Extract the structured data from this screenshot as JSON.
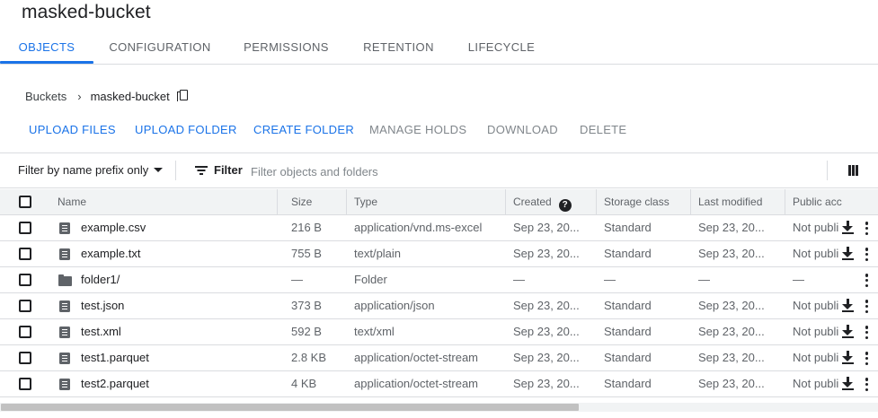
{
  "bucket": {
    "name": "masked-bucket"
  },
  "tabs": [
    {
      "label": "OBJECTS",
      "active": true
    },
    {
      "label": "CONFIGURATION",
      "active": false
    },
    {
      "label": "PERMISSIONS",
      "active": false
    },
    {
      "label": "RETENTION",
      "active": false
    },
    {
      "label": "LIFECYCLE",
      "active": false
    }
  ],
  "breadcrumb": {
    "root": "Buckets",
    "separator": "›",
    "current": "masked-bucket"
  },
  "actions": [
    {
      "label": "UPLOAD FILES",
      "enabled": true
    },
    {
      "label": "UPLOAD FOLDER",
      "enabled": true
    },
    {
      "label": "CREATE FOLDER",
      "enabled": true
    },
    {
      "label": "MANAGE HOLDS",
      "enabled": false
    },
    {
      "label": "DOWNLOAD",
      "enabled": false
    },
    {
      "label": "DELETE",
      "enabled": false
    }
  ],
  "filter": {
    "mode_label": "Filter by name prefix only",
    "button_label": "Filter",
    "placeholder": "Filter objects and folders"
  },
  "table": {
    "columns": [
      "Name",
      "Size",
      "Type",
      "Created",
      "Storage class",
      "Last modified",
      "Public acc"
    ],
    "rows": [
      {
        "name": "example.csv",
        "kind": "file",
        "size": "216 B",
        "type": "application/vnd.ms-excel",
        "created": "Sep 23, 20...",
        "storage": "Standard",
        "modified": "Sep 23, 20...",
        "public": "Not publi"
      },
      {
        "name": "example.txt",
        "kind": "file",
        "size": "755 B",
        "type": "text/plain",
        "created": "Sep 23, 20...",
        "storage": "Standard",
        "modified": "Sep 23, 20...",
        "public": "Not publi"
      },
      {
        "name": "folder1/",
        "kind": "folder",
        "size": "—",
        "type": "Folder",
        "created": "—",
        "storage": "—",
        "modified": "—",
        "public": "—"
      },
      {
        "name": "test.json",
        "kind": "file",
        "size": "373 B",
        "type": "application/json",
        "created": "Sep 23, 20...",
        "storage": "Standard",
        "modified": "Sep 23, 20...",
        "public": "Not publi"
      },
      {
        "name": "test.xml",
        "kind": "file",
        "size": "592 B",
        "type": "text/xml",
        "created": "Sep 23, 20...",
        "storage": "Standard",
        "modified": "Sep 23, 20...",
        "public": "Not publi"
      },
      {
        "name": "test1.parquet",
        "kind": "file",
        "size": "2.8 KB",
        "type": "application/octet-stream",
        "created": "Sep 23, 20...",
        "storage": "Standard",
        "modified": "Sep 23, 20...",
        "public": "Not publi"
      },
      {
        "name": "test2.parquet",
        "kind": "file",
        "size": "4 KB",
        "type": "application/octet-stream",
        "created": "Sep 23, 20...",
        "storage": "Standard",
        "modified": "Sep 23, 20...",
        "public": "Not publi"
      }
    ]
  },
  "colors": {
    "accent": "#1a73e8",
    "text": "#202124",
    "muted": "#5f6368",
    "disabled": "#80868b",
    "divider": "#dadce0",
    "header_bg": "#f1f3f4"
  }
}
